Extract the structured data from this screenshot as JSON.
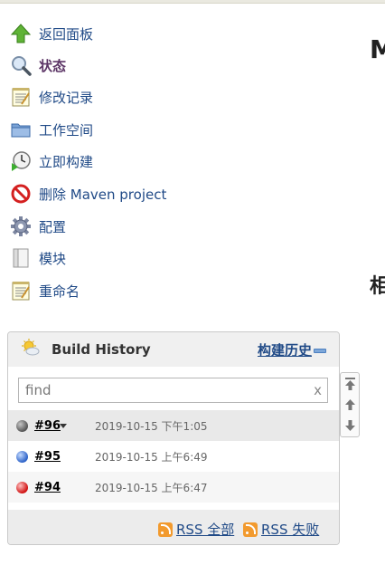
{
  "sidebar": {
    "items": [
      {
        "label": "返回面板",
        "icon": "up-arrow-icon"
      },
      {
        "label": "状态",
        "icon": "magnifier-icon",
        "active": true
      },
      {
        "label": "修改记录",
        "icon": "notepad-icon"
      },
      {
        "label": "工作空间",
        "icon": "folder-icon"
      },
      {
        "label": "立即构建",
        "icon": "clock-play-icon"
      },
      {
        "label": "删除 Maven project",
        "icon": "no-entry-icon"
      },
      {
        "label": "配置",
        "icon": "gear-icon"
      },
      {
        "label": "模块",
        "icon": "document-icon"
      },
      {
        "label": "重命名",
        "icon": "notepad-icon"
      }
    ]
  },
  "main": {
    "heading_1": "M",
    "heading_2": "相"
  },
  "build_history": {
    "title": "Build History",
    "trend_link": "构建历史",
    "search_placeholder": "find",
    "clear_label": "x",
    "builds": [
      {
        "number": "#96",
        "time": "2019-10-15 下午1:05",
        "status_color": "#777777",
        "has_menu": true,
        "highlighted": true
      },
      {
        "number": "#95",
        "time": "2019-10-15 上午6:49",
        "status_color": "#4a7fd4",
        "has_menu": false,
        "highlighted": false
      },
      {
        "number": "#94",
        "time": "2019-10-15 上午6:47",
        "status_color": "#e02e2e",
        "has_menu": false,
        "highlighted": false
      }
    ],
    "rss_all": "RSS 全部",
    "rss_failed": "RSS 失败"
  },
  "colors": {
    "link": "#204a87",
    "success": "#4a7fd4",
    "failed": "#e02e2e",
    "in_progress": "#777777",
    "rss": "#f29a2e"
  }
}
